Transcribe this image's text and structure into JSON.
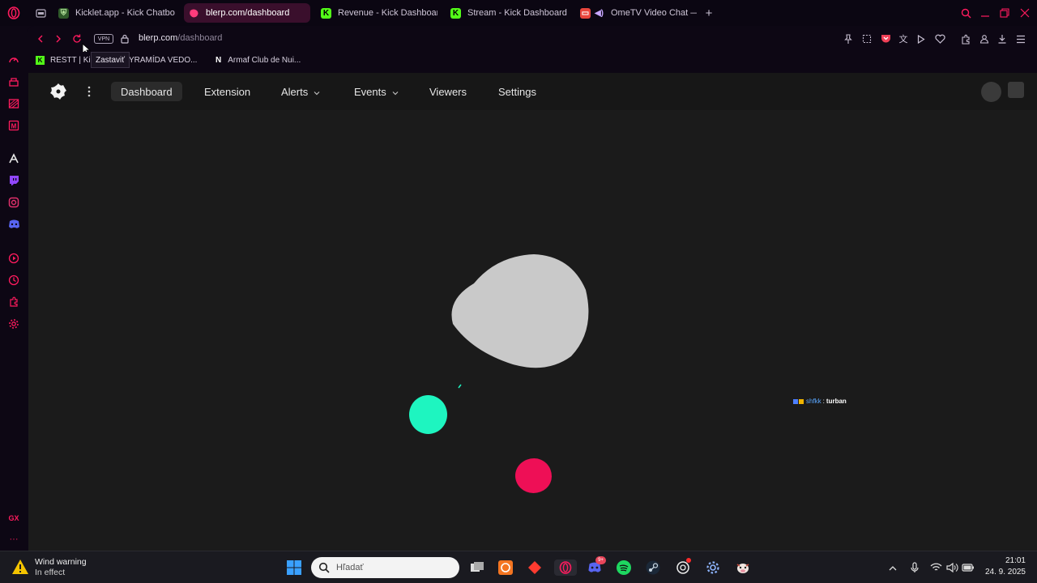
{
  "browser": {
    "tabs": [
      {
        "title": "Kicklet.app - Kick Chatbo",
        "active": false
      },
      {
        "title": "blerp.com/dashboard",
        "active": true
      },
      {
        "title": "Revenue - Kick Dashboar",
        "active": false
      },
      {
        "title": "Stream - Kick Dashboard",
        "active": false
      },
      {
        "title": "OmeTV Video Chat —",
        "active": false
      }
    ],
    "new_tab": "+",
    "address": {
      "vpn": "VPN",
      "host": "blerp.com",
      "path": "/dashboard"
    },
    "tooltip": "Zastaviť",
    "bookmarks": [
      {
        "label": "RESTT | Ki",
        "icon": "kick-icon"
      },
      {
        "label": "YRAMÍDA VEDO...",
        "icon": "folder-icon"
      },
      {
        "label": "Armaf Club de Nui...",
        "icon": "notion-icon"
      }
    ],
    "sidebar_badge": "GX",
    "sidebar_more": "···"
  },
  "page": {
    "nav": {
      "items": [
        {
          "label": "Dashboard",
          "active": true
        },
        {
          "label": "Extension",
          "active": false
        },
        {
          "label": "Alerts",
          "dropdown": true
        },
        {
          "label": "Events",
          "dropdown": true
        },
        {
          "label": "Viewers",
          "active": false
        },
        {
          "label": "Settings",
          "active": false
        }
      ]
    },
    "chat_overlay": {
      "user": "shfkk",
      "message": "turban"
    },
    "colors": {
      "blob_gray": "#c9c9c9",
      "blob_teal": "#1ef5c0",
      "blob_pink": "#ee0f56"
    }
  },
  "taskbar": {
    "weather_title": "Wind warning",
    "weather_sub": "In effect",
    "search_placeholder": "Hľadať",
    "discord_badge": "9+",
    "time": "21:01",
    "date": "24. 9. 2025"
  }
}
